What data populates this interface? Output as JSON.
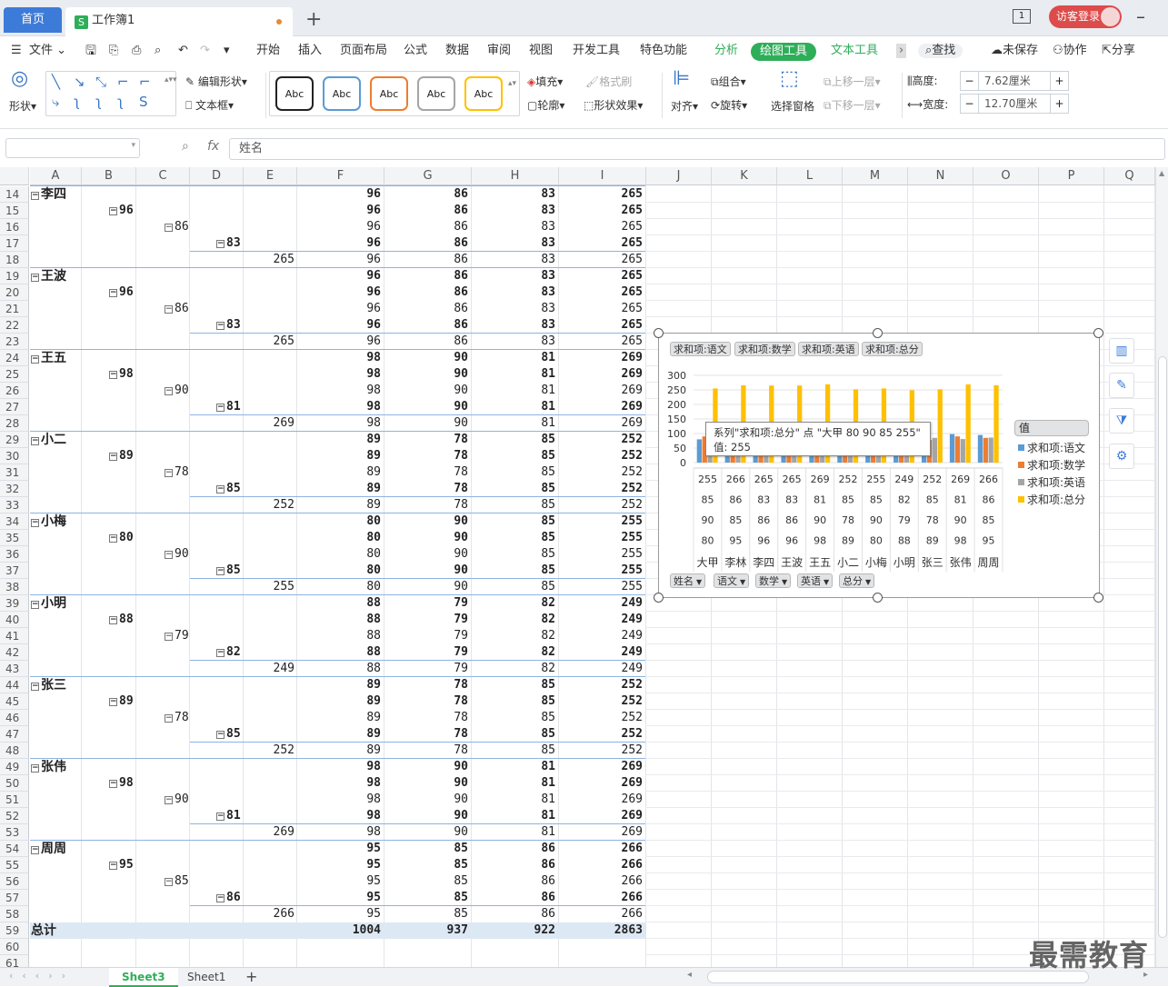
{
  "titlebar": {
    "home_tab": "首页",
    "doc_logo": "S",
    "doc_tab": "工作簿1",
    "new_tab": "+",
    "window_count": "1",
    "login": "访客登录"
  },
  "menu": {
    "file": "文件",
    "items": [
      "开始",
      "插入",
      "页面布局",
      "公式",
      "数据",
      "审阅",
      "视图",
      "开发工具",
      "特色功能"
    ],
    "analyze": "分析",
    "drawing_tools": "绘图工具",
    "text_tools": "文本工具",
    "search": "查找",
    "unsaved": "未保存",
    "collab": "协作",
    "share": "分享"
  },
  "ribbon": {
    "shape": "形状",
    "edit_shape": "编辑形状",
    "text_box": "文本框",
    "style_samples": [
      "Abc",
      "Abc",
      "Abc",
      "Abc",
      "Abc"
    ],
    "style_colors": [
      "#222222",
      "#5b9bd5",
      "#ed7d31",
      "#a5a5a5",
      "#ffc000"
    ],
    "fill": "填充",
    "format_painter": "格式刷",
    "outline": "轮廓",
    "shape_effects": "形状效果",
    "align": "对齐",
    "group": "组合",
    "rotate": "旋转",
    "selection_pane": "选择窗格",
    "bring_forward": "上移一层",
    "send_backward": "下移一层",
    "height_label": "高度:",
    "height_value": "7.62厘米",
    "width_label": "宽度:",
    "width_value": "12.70厘米"
  },
  "formula_bar": {
    "fx": "fx",
    "content": "姓名"
  },
  "columns": [
    "A",
    "B",
    "C",
    "D",
    "E",
    "F",
    "G",
    "H",
    "I",
    "J",
    "K",
    "L",
    "M",
    "N",
    "O",
    "P",
    "Q"
  ],
  "rows": [
    {
      "n": "14",
      "lvl": 0,
      "label": "李四",
      "f": "96",
      "g": "86",
      "h": "83",
      "i": "265"
    },
    {
      "n": "15",
      "lvl": 1,
      "label": "96",
      "f": "96",
      "g": "86",
      "h": "83",
      "i": "265"
    },
    {
      "n": "16",
      "lvl": 2,
      "label": "86",
      "f": "96",
      "g": "86",
      "h": "83",
      "i": "265"
    },
    {
      "n": "17",
      "lvl": 3,
      "label": "83",
      "f": "96",
      "g": "86",
      "h": "83",
      "i": "265"
    },
    {
      "n": "18",
      "lvl": 4,
      "label": "265",
      "f": "96",
      "g": "86",
      "h": "83",
      "i": "265"
    },
    {
      "n": "19",
      "lvl": 0,
      "label": "王波",
      "f": "96",
      "g": "86",
      "h": "83",
      "i": "265"
    },
    {
      "n": "20",
      "lvl": 1,
      "label": "96",
      "f": "96",
      "g": "86",
      "h": "83",
      "i": "265"
    },
    {
      "n": "21",
      "lvl": 2,
      "label": "86",
      "f": "96",
      "g": "86",
      "h": "83",
      "i": "265"
    },
    {
      "n": "22",
      "lvl": 3,
      "label": "83",
      "f": "96",
      "g": "86",
      "h": "83",
      "i": "265"
    },
    {
      "n": "23",
      "lvl": 4,
      "label": "265",
      "f": "96",
      "g": "86",
      "h": "83",
      "i": "265"
    },
    {
      "n": "24",
      "lvl": 0,
      "label": "王五",
      "f": "98",
      "g": "90",
      "h": "81",
      "i": "269"
    },
    {
      "n": "25",
      "lvl": 1,
      "label": "98",
      "f": "98",
      "g": "90",
      "h": "81",
      "i": "269"
    },
    {
      "n": "26",
      "lvl": 2,
      "label": "90",
      "f": "98",
      "g": "90",
      "h": "81",
      "i": "269"
    },
    {
      "n": "27",
      "lvl": 3,
      "label": "81",
      "f": "98",
      "g": "90",
      "h": "81",
      "i": "269"
    },
    {
      "n": "28",
      "lvl": 4,
      "label": "269",
      "f": "98",
      "g": "90",
      "h": "81",
      "i": "269"
    },
    {
      "n": "29",
      "lvl": 0,
      "label": "小二",
      "f": "89",
      "g": "78",
      "h": "85",
      "i": "252"
    },
    {
      "n": "30",
      "lvl": 1,
      "label": "89",
      "f": "89",
      "g": "78",
      "h": "85",
      "i": "252"
    },
    {
      "n": "31",
      "lvl": 2,
      "label": "78",
      "f": "89",
      "g": "78",
      "h": "85",
      "i": "252"
    },
    {
      "n": "32",
      "lvl": 3,
      "label": "85",
      "f": "89",
      "g": "78",
      "h": "85",
      "i": "252"
    },
    {
      "n": "33",
      "lvl": 4,
      "label": "252",
      "f": "89",
      "g": "78",
      "h": "85",
      "i": "252"
    },
    {
      "n": "34",
      "lvl": 0,
      "label": "小梅",
      "f": "80",
      "g": "90",
      "h": "85",
      "i": "255"
    },
    {
      "n": "35",
      "lvl": 1,
      "label": "80",
      "f": "80",
      "g": "90",
      "h": "85",
      "i": "255"
    },
    {
      "n": "36",
      "lvl": 2,
      "label": "90",
      "f": "80",
      "g": "90",
      "h": "85",
      "i": "255"
    },
    {
      "n": "37",
      "lvl": 3,
      "label": "85",
      "f": "80",
      "g": "90",
      "h": "85",
      "i": "255"
    },
    {
      "n": "38",
      "lvl": 4,
      "label": "255",
      "f": "80",
      "g": "90",
      "h": "85",
      "i": "255"
    },
    {
      "n": "39",
      "lvl": 0,
      "label": "小明",
      "f": "88",
      "g": "79",
      "h": "82",
      "i": "249"
    },
    {
      "n": "40",
      "lvl": 1,
      "label": "88",
      "f": "88",
      "g": "79",
      "h": "82",
      "i": "249"
    },
    {
      "n": "41",
      "lvl": 2,
      "label": "79",
      "f": "88",
      "g": "79",
      "h": "82",
      "i": "249"
    },
    {
      "n": "42",
      "lvl": 3,
      "label": "82",
      "f": "88",
      "g": "79",
      "h": "82",
      "i": "249"
    },
    {
      "n": "43",
      "lvl": 4,
      "label": "249",
      "f": "88",
      "g": "79",
      "h": "82",
      "i": "249"
    },
    {
      "n": "44",
      "lvl": 0,
      "label": "张三",
      "f": "89",
      "g": "78",
      "h": "85",
      "i": "252"
    },
    {
      "n": "45",
      "lvl": 1,
      "label": "89",
      "f": "89",
      "g": "78",
      "h": "85",
      "i": "252"
    },
    {
      "n": "46",
      "lvl": 2,
      "label": "78",
      "f": "89",
      "g": "78",
      "h": "85",
      "i": "252"
    },
    {
      "n": "47",
      "lvl": 3,
      "label": "85",
      "f": "89",
      "g": "78",
      "h": "85",
      "i": "252"
    },
    {
      "n": "48",
      "lvl": 4,
      "label": "252",
      "f": "89",
      "g": "78",
      "h": "85",
      "i": "252"
    },
    {
      "n": "49",
      "lvl": 0,
      "label": "张伟",
      "f": "98",
      "g": "90",
      "h": "81",
      "i": "269"
    },
    {
      "n": "50",
      "lvl": 1,
      "label": "98",
      "f": "98",
      "g": "90",
      "h": "81",
      "i": "269"
    },
    {
      "n": "51",
      "lvl": 2,
      "label": "90",
      "f": "98",
      "g": "90",
      "h": "81",
      "i": "269"
    },
    {
      "n": "52",
      "lvl": 3,
      "label": "81",
      "f": "98",
      "g": "90",
      "h": "81",
      "i": "269"
    },
    {
      "n": "53",
      "lvl": 4,
      "label": "269",
      "f": "98",
      "g": "90",
      "h": "81",
      "i": "269"
    },
    {
      "n": "54",
      "lvl": 0,
      "label": "周周",
      "f": "95",
      "g": "85",
      "h": "86",
      "i": "266"
    },
    {
      "n": "55",
      "lvl": 1,
      "label": "95",
      "f": "95",
      "g": "85",
      "h": "86",
      "i": "266"
    },
    {
      "n": "56",
      "lvl": 2,
      "label": "85",
      "f": "95",
      "g": "85",
      "h": "86",
      "i": "266"
    },
    {
      "n": "57",
      "lvl": 3,
      "label": "86",
      "f": "95",
      "g": "85",
      "h": "86",
      "i": "266"
    },
    {
      "n": "58",
      "lvl": 4,
      "label": "266",
      "f": "95",
      "g": "85",
      "h": "86",
      "i": "266"
    },
    {
      "n": "59",
      "lvl": 5,
      "label": "总计",
      "f": "1004",
      "g": "937",
      "h": "922",
      "i": "2863"
    },
    {
      "n": "60",
      "lvl": -1,
      "label": "",
      "f": "",
      "g": "",
      "h": "",
      "i": ""
    },
    {
      "n": "61",
      "lvl": -1,
      "label": "",
      "f": "",
      "g": "",
      "h": "",
      "i": ""
    }
  ],
  "chart_data": {
    "type": "bar",
    "categories": [
      "大甲",
      "李林",
      "李四",
      "王波",
      "王五",
      "小二",
      "小梅",
      "小明",
      "张三",
      "张伟",
      "周周"
    ],
    "series": [
      {
        "name": "求和项:语文",
        "color": "#5b9bd5",
        "values": [
          80,
          95,
          96,
          96,
          98,
          89,
          80,
          88,
          89,
          98,
          95
        ]
      },
      {
        "name": "求和项:数学",
        "color": "#ed7d31",
        "values": [
          90,
          85,
          86,
          86,
          90,
          78,
          90,
          79,
          78,
          90,
          85
        ]
      },
      {
        "name": "求和项:英语",
        "color": "#a5a5a5",
        "values": [
          85,
          86,
          83,
          83,
          81,
          85,
          85,
          82,
          85,
          81,
          86
        ]
      },
      {
        "name": "求和项:总分",
        "color": "#ffc000",
        "values": [
          255,
          266,
          265,
          265,
          269,
          252,
          255,
          249,
          252,
          269,
          266
        ]
      }
    ],
    "ylim": [
      0,
      300
    ],
    "yticks": [
      "300",
      "250",
      "200",
      "150",
      "100",
      "50",
      "0"
    ],
    "table_rows_order": [
      3,
      2,
      1,
      0
    ],
    "legend_title": "值",
    "legend_position": "right",
    "top_field_buttons": [
      "求和项:语文",
      "求和项:数学",
      "求和项:英语",
      "求和项:总分"
    ],
    "bottom_field_buttons": [
      "姓名",
      "语文",
      "数学",
      "英语",
      "总分"
    ],
    "tooltip": {
      "line1": "系列\"求和项:总分\" 点 \"大甲 80 90 85 255\"",
      "line2": "值: 255"
    }
  },
  "sheets": {
    "tabs": [
      "Sheet3",
      "Sheet1"
    ],
    "active": "Sheet3",
    "add": "+"
  },
  "watermark": "最需教育"
}
